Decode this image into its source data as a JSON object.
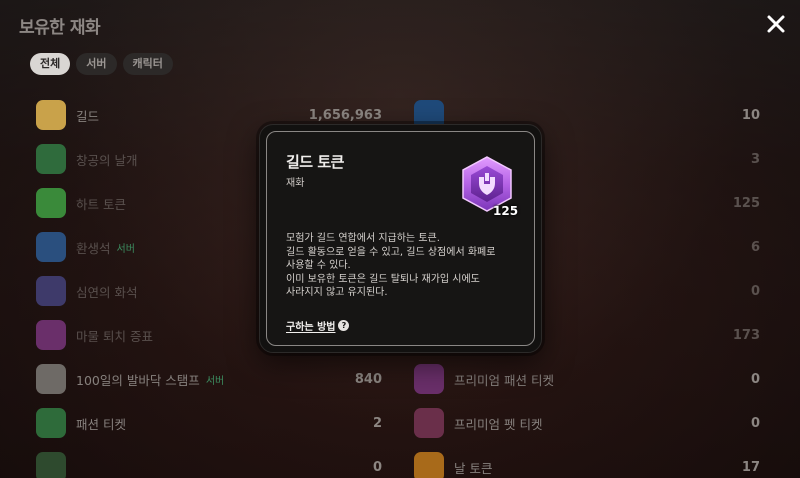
{
  "window": {
    "title": "보유한 재화"
  },
  "tabs": [
    {
      "label": "전체",
      "active": true
    },
    {
      "label": "서버",
      "active": false
    },
    {
      "label": "캐릭터",
      "active": false
    }
  ],
  "left_items": [
    {
      "name": "길드",
      "tag": "",
      "value": "1,656,963",
      "icon": "gold-coin-icon",
      "color": "#c9a24a"
    },
    {
      "name": "창공의 날개",
      "tag": "",
      "value": "",
      "icon": "wing-icon",
      "color": "#2f6b3c"
    },
    {
      "name": "하트 토큰",
      "tag": "",
      "value": "",
      "icon": "heart-token-icon",
      "color": "#3a8a3a"
    },
    {
      "name": "환생석",
      "tag": "서버",
      "value": "",
      "icon": "star-gem-icon",
      "color": "#2a4f7e"
    },
    {
      "name": "심연의 화석",
      "tag": "",
      "value": "",
      "icon": "fossil-icon",
      "color": "#3e3a6a"
    },
    {
      "name": "마물 퇴치 증표",
      "tag": "",
      "value": "",
      "icon": "proof-badge-icon",
      "color": "#6a2f6a"
    },
    {
      "name": "100일의 발바닥 스탬프",
      "tag": "서버",
      "value": "840",
      "icon": "stamp-icon",
      "color": "#6e6a66"
    },
    {
      "name": "패션 티켓",
      "tag": "",
      "value": "2",
      "icon": "fashion-ticket-icon",
      "color": "#2e6b3a"
    },
    {
      "name": "",
      "tag": "",
      "value": "0",
      "icon": "misc-icon",
      "color": "#2e4a2e"
    }
  ],
  "right_items": [
    {
      "name": "",
      "tag": "",
      "value": "10",
      "icon": "blue-orb-icon",
      "color": "#1f4a7a"
    },
    {
      "name": "",
      "tag": "",
      "value": "3",
      "icon": "",
      "color": ""
    },
    {
      "name": "",
      "tag": "",
      "value": "125",
      "icon": "",
      "color": ""
    },
    {
      "name": "",
      "tag": "",
      "value": "6",
      "icon": "",
      "color": ""
    },
    {
      "name": "",
      "tag": "",
      "value": "0",
      "icon": "",
      "color": ""
    },
    {
      "name": "",
      "tag": "",
      "value": "173",
      "icon": "",
      "color": ""
    },
    {
      "name": "프리미엄 패션 티켓",
      "tag": "",
      "value": "0",
      "icon": "premium-fashion-ticket-icon",
      "color": "#6a2f6a"
    },
    {
      "name": "프리미엄 펫 티켓",
      "tag": "",
      "value": "0",
      "icon": "premium-pet-ticket-icon",
      "color": "#6a2f4a"
    },
    {
      "name": "날 토큰",
      "tag": "",
      "value": "17",
      "icon": "orange-token-icon",
      "color": "#a86a1a"
    }
  ],
  "modal": {
    "title": "길드 토큰",
    "subtitle": "재화",
    "count": "125",
    "description": [
      "모험가 길드 연합에서 지급하는 토큰.",
      "길드 활동으로 얻을 수 있고, 길드 상점에서 화폐로",
      "사용할 수 있다.",
      "이미 보유한 토큰은 길드 탈퇴나 재가입 시에도",
      "사라지지 않고 유지된다."
    ],
    "link_label": "구하는 방법",
    "help_glyph": "?"
  },
  "colors": {
    "token_purple": "#b563e6",
    "token_dark": "#6a2a9a"
  }
}
